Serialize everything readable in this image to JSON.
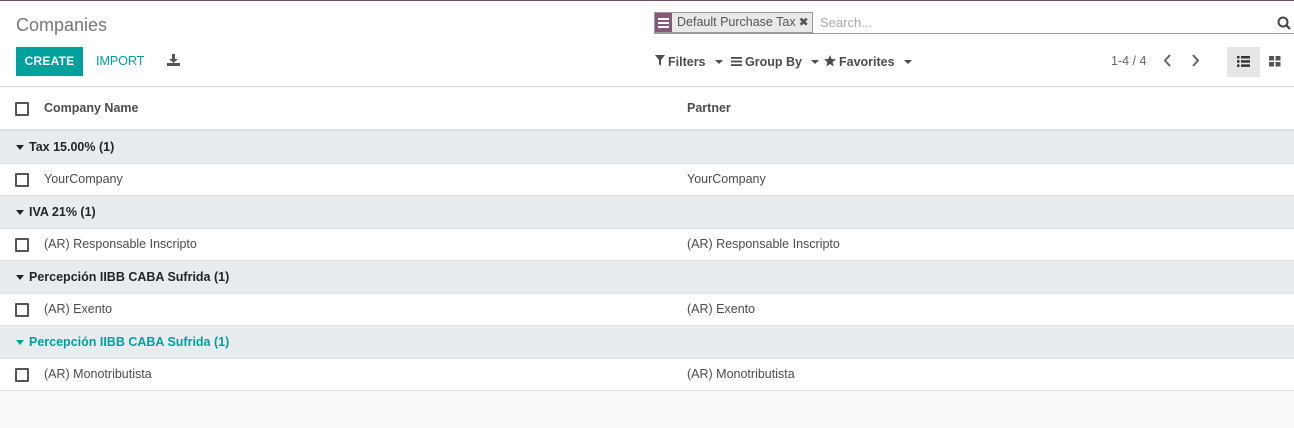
{
  "breadcrumb": {
    "title": "Companies"
  },
  "search": {
    "facet_label": "Default Purchase Tax",
    "placeholder": "Search..."
  },
  "toolbar": {
    "create_label": "CREATE",
    "import_label": "IMPORT"
  },
  "filters": {
    "filters_label": "Filters",
    "groupby_label": "Group By",
    "favorites_label": "Favorites"
  },
  "pager": {
    "value": "1-4 / 4"
  },
  "table": {
    "columns": [
      "Company Name",
      "Partner"
    ],
    "groups": [
      {
        "label": "Tax 15.00% (1)",
        "row": {
          "name": "YourCompany",
          "partner": "YourCompany"
        }
      },
      {
        "label": "IVA 21% (1)",
        "row": {
          "name": "(AR) Responsable Inscripto",
          "partner": "(AR) Responsable Inscripto"
        }
      },
      {
        "label": "Percepción IIBB CABA Sufrida (1)",
        "row": {
          "name": "(AR) Exento",
          "partner": "(AR) Exento"
        }
      },
      {
        "label": "Percepción IIBB CABA Sufrida (1)",
        "row": {
          "name": "(AR) Monotributista",
          "partner": "(AR) Monotributista"
        }
      }
    ]
  },
  "colors": {
    "accent": "#00a09d",
    "brand": "#875a7b",
    "group_bg": "#e9ecef"
  }
}
